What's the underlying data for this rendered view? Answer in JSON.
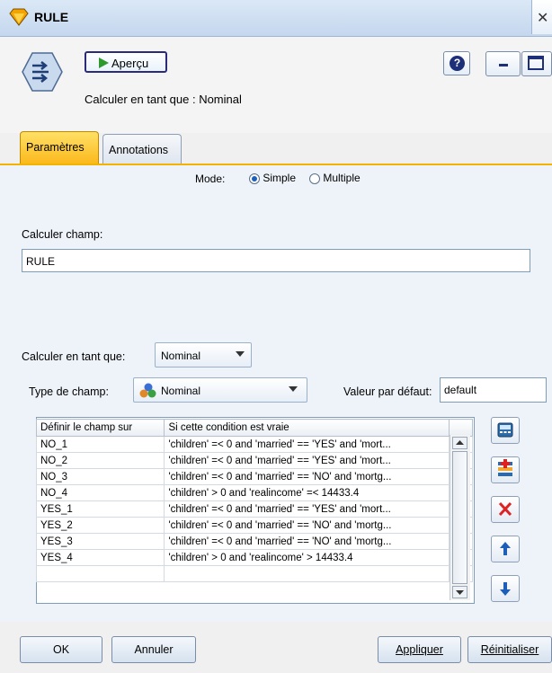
{
  "window": {
    "title": "RULE"
  },
  "toolbar": {
    "preview_label": "Aperçu",
    "help_icon": "?"
  },
  "header": {
    "compute_as_text": "Calculer en tant que : Nominal"
  },
  "tabs": [
    {
      "label": "Paramètres",
      "active": true
    },
    {
      "label": "Annotations",
      "active": false
    }
  ],
  "mode": {
    "label": "Mode:",
    "options": [
      "Simple",
      "Multiple"
    ],
    "selected": "Simple"
  },
  "compute_field": {
    "label": "Calculer champ:",
    "value": "RULE"
  },
  "compute_as": {
    "label": "Calculer en tant que:",
    "value": "Nominal"
  },
  "field_type": {
    "label": "Type de champ:",
    "value": "Nominal"
  },
  "default_value": {
    "label": "Valeur par défaut:",
    "value": "default"
  },
  "table": {
    "columns": [
      "Définir le champ sur",
      "Si cette condition est vraie"
    ],
    "rows": [
      [
        "NO_1",
        "'children' =< 0 and 'married' == 'YES' and 'mort..."
      ],
      [
        "NO_2",
        "'children' =< 0 and 'married' == 'YES' and 'mort..."
      ],
      [
        "NO_3",
        "'children' =< 0 and 'married' == 'NO' and 'mortg..."
      ],
      [
        "NO_4",
        "'children' > 0 and 'realincome' =< 14433.4"
      ],
      [
        "YES_1",
        "'children' =< 0 and 'married' == 'YES' and 'mort..."
      ],
      [
        "YES_2",
        "'children' =< 0 and 'married' == 'NO' and 'mortg..."
      ],
      [
        "YES_3",
        "'children' =< 0 and 'married' == 'NO' and 'mortg..."
      ],
      [
        "YES_4",
        "'children' > 0 and 'realincome' > 14433.4"
      ],
      [
        "",
        ""
      ]
    ]
  },
  "footer": {
    "ok_label": "OK",
    "cancel_label": "Annuler",
    "apply_label": "Appliquer",
    "reset_label": "Réinitialiser"
  },
  "colors": {
    "active_tab": "#fbb91c",
    "accent_blue": "#1d5fb8",
    "delete_red": "#d22"
  }
}
